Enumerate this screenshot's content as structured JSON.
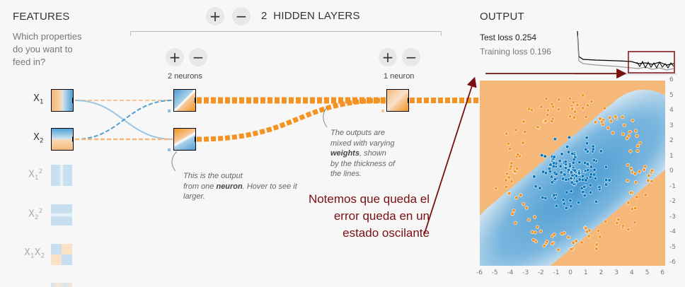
{
  "features": {
    "title": "FEATURES",
    "question": [
      "Which properties",
      "do you want to",
      "feed in?"
    ],
    "items": [
      {
        "base": "X",
        "sub": "1",
        "sup": "",
        "active": true
      },
      {
        "base": "X",
        "sub": "2",
        "sup": "",
        "active": true
      },
      {
        "base": "X",
        "sub": "1",
        "sup": "2",
        "active": false
      },
      {
        "base": "X",
        "sub": "2",
        "sup": "2",
        "active": false
      },
      {
        "base": "X",
        "sub": "1",
        "sup": "",
        "base2": "X",
        "sub2": "2",
        "active": false
      }
    ]
  },
  "hidden": {
    "count": "2",
    "label": "HIDDEN LAYERS",
    "add_symbol": "+",
    "remove_symbol": "−",
    "layers": [
      {
        "neurons_label": "2 neurons"
      },
      {
        "neurons_label": "1 neuron"
      }
    ]
  },
  "notes": {
    "neuron": [
      "This is the output",
      "from one ",
      "neuron",
      ". Hover to see it",
      "larger."
    ],
    "weights": [
      "The outputs are",
      "mixed with varying",
      "weights",
      ", shown",
      "by the thickness of",
      "the lines."
    ]
  },
  "output": {
    "title": "OUTPUT",
    "test_loss_label": "Test loss",
    "test_loss_value": "0.254",
    "training_loss_label": "Training loss",
    "training_loss_value": "0.196"
  },
  "annotation": [
    "Notemos que queda el",
    "error queda en un",
    "estado oscilante"
  ],
  "axis_ticks_x": [
    "-6",
    "-5",
    "-4",
    "-3",
    "-2",
    "-1",
    "0",
    "1",
    "2",
    "3",
    "4",
    "5",
    "6"
  ],
  "axis_ticks_y": [
    "6",
    "5",
    "4",
    "3",
    "2",
    "1",
    "0",
    "-1",
    "-2",
    "-3",
    "-4",
    "-5",
    "-6"
  ],
  "colors": {
    "orange": "#f59322",
    "blue": "#0877bd",
    "annotation": "#7a0f12"
  }
}
